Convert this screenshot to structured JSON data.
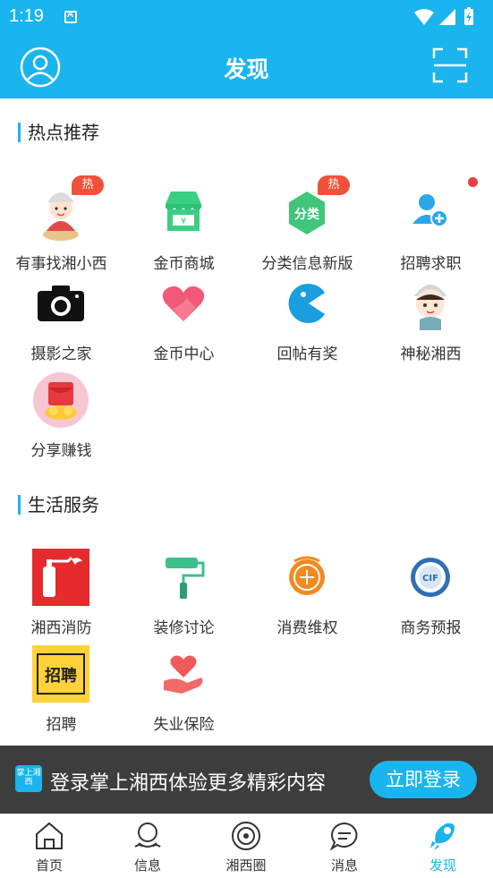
{
  "status_bar": {
    "time": "1:19"
  },
  "header": {
    "title": "发现"
  },
  "sections": [
    {
      "title": "热点推荐"
    },
    {
      "title": "生活服务"
    }
  ],
  "hot": {
    "items": [
      {
        "label": "有事找湘小西",
        "icon": "girl-mascot-icon",
        "badge": "热"
      },
      {
        "label": "金币商城",
        "icon": "store-icon"
      },
      {
        "label": "分类信息新版",
        "icon": "category-icon",
        "badge": "热"
      },
      {
        "label": "招聘求职",
        "icon": "user-add-icon"
      },
      {
        "label": "摄影之家",
        "icon": "camera-icon"
      },
      {
        "label": "金币中心",
        "icon": "heart-icon"
      },
      {
        "label": "回帖有奖",
        "icon": "reply-reward-icon"
      },
      {
        "label": "神秘湘西",
        "icon": "boy-mascot-icon"
      },
      {
        "label": "分享赚钱",
        "icon": "red-packet-icon"
      }
    ]
  },
  "life": {
    "items": [
      {
        "label": "湘西消防",
        "icon": "fire-extinguisher-icon"
      },
      {
        "label": "装修讨论",
        "icon": "paint-roller-icon"
      },
      {
        "label": "消费维权",
        "icon": "consumer-rights-icon"
      },
      {
        "label": "商务预报",
        "icon": "cif-icon"
      },
      {
        "label": "招聘",
        "icon": "recruit-sign-icon"
      },
      {
        "label": "失业保险",
        "icon": "insurance-hand-icon"
      }
    ]
  },
  "login_bar": {
    "logo_text": "掌上湘西",
    "text": "登录掌上湘西体验更多精彩内容",
    "button": "立即登录"
  },
  "tabs": [
    {
      "label": "首页",
      "icon": "home-icon"
    },
    {
      "label": "信息",
      "icon": "info-icon"
    },
    {
      "label": "湘西圈",
      "icon": "circle-icon"
    },
    {
      "label": "消息",
      "icon": "message-icon"
    },
    {
      "label": "发现",
      "icon": "rocket-icon",
      "active": true
    }
  ],
  "colors": {
    "primary": "#1ab4ee",
    "hot_badge": "#f0513a",
    "login_bar": "#3d3d3d"
  }
}
